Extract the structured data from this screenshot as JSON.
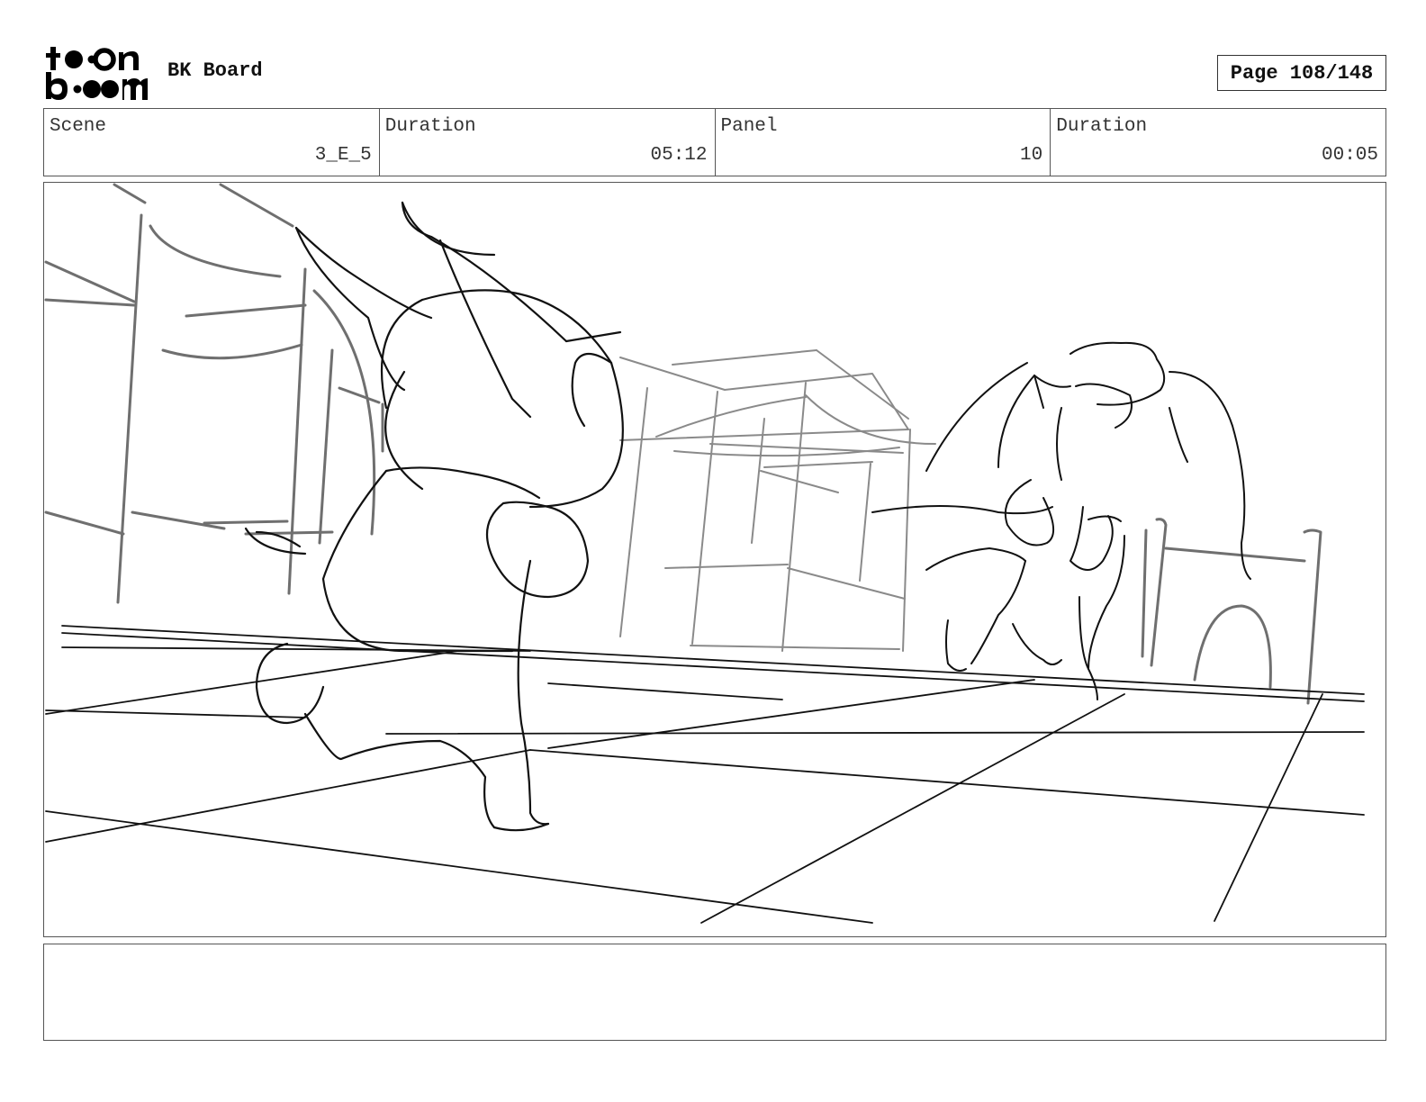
{
  "header": {
    "board_title": "BK Board",
    "page_label": "Page 108/148"
  },
  "info": {
    "scene_label": "Scene",
    "scene_value": "3_E_5",
    "scene_duration_label": "Duration",
    "scene_duration_value": "05:12",
    "panel_label": "Panel",
    "panel_value": "10",
    "panel_duration_label": "Duration",
    "panel_duration_value": "00:05"
  },
  "notes": {
    "text": ""
  }
}
